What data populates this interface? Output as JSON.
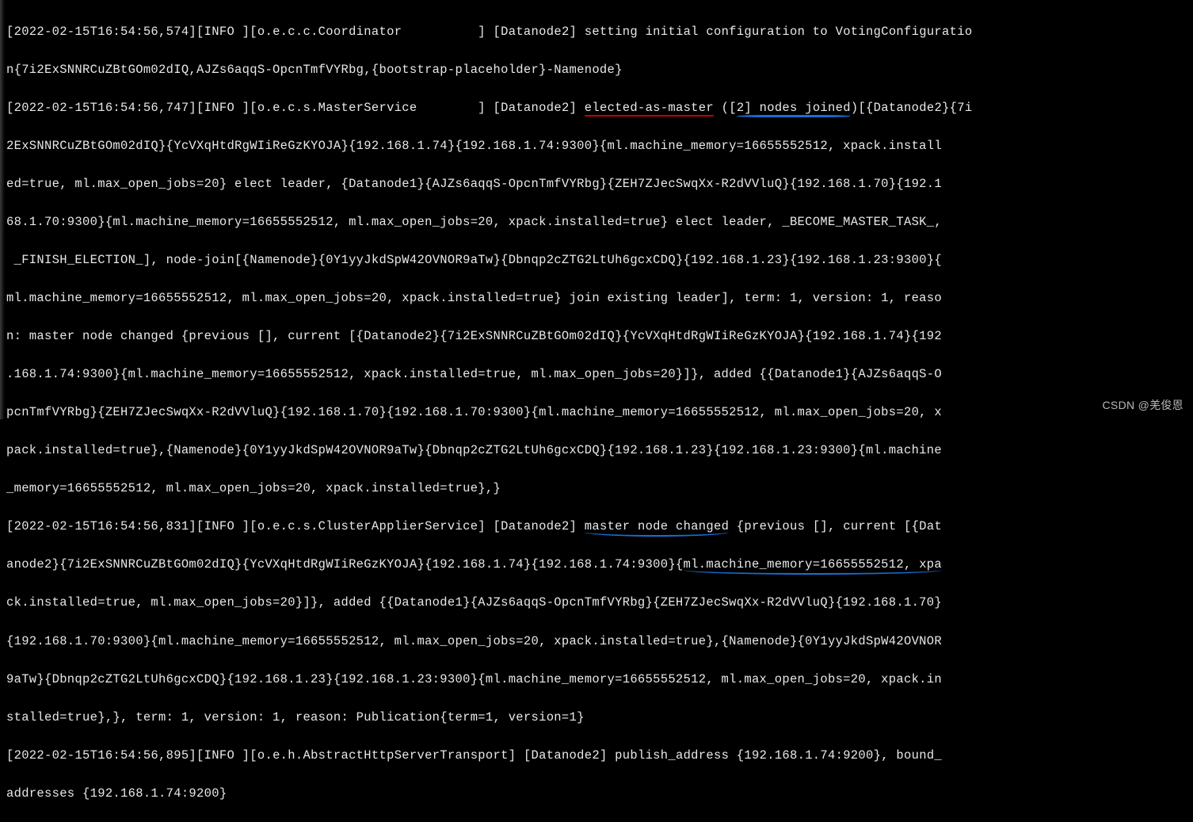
{
  "log_entries": {
    "entry1": {
      "timestamp": "[2022-02-15T16:54:56,574]",
      "level": "[INFO ]",
      "logger": "[o.e.c.c.Coordinator          ]",
      "node": "[Datanode2]",
      "msg_a": " setting initial configuration to VotingConfiguratio",
      "msg_b": "n{7i2ExSNNRCuZBtGOm02dIQ,AJZs6aqqS-OpcnTmfVYRbg,{bootstrap-placeholder}-Namenode}"
    },
    "entry2": {
      "timestamp": "[2022-02-15T16:54:56,747]",
      "level": "[INFO ]",
      "logger": "[o.e.c.s.MasterService        ]",
      "node": "[Datanode2]",
      "elected": "elected-as-master",
      "nodes_joined_prefix": " ([",
      "nodes_joined": "2] nodes joined",
      "nodes_joined_suffix": ")[{Datanode2}{7i",
      "line2": "2ExSNNRCuZBtGOm02dIQ}{YcVXqHtdRgWIiReGzKYOJA}{192.168.1.74}{192.168.1.74:9300}{ml.machine_memory=16655552512, xpack.install",
      "line3": "ed=true, ml.max_open_jobs=20} elect leader, {Datanode1}{AJZs6aqqS-OpcnTmfVYRbg}{ZEH7ZJecSwqXx-R2dVVluQ}{192.168.1.70}{192.1",
      "line4": "68.1.70:9300}{ml.machine_memory=16655552512, ml.max_open_jobs=20, xpack.installed=true} elect leader, _BECOME_MASTER_TASK_,",
      "line5": " _FINISH_ELECTION_], node-join[{Namenode}{0Y1yyJkdSpW42OVNOR9aTw}{Dbnqp2cZTG2LtUh6gcxCDQ}{192.168.1.23}{192.168.1.23:9300}{",
      "line6": "ml.machine_memory=16655552512, ml.max_open_jobs=20, xpack.installed=true} join existing leader], term: 1, version: 1, reaso",
      "line7": "n: master node changed {previous [], current [{Datanode2}{7i2ExSNNRCuZBtGOm02dIQ}{YcVXqHtdRgWIiReGzKYOJA}{192.168.1.74}{192",
      "line8": ".168.1.74:9300}{ml.machine_memory=16655552512, xpack.installed=true, ml.max_open_jobs=20}]}, added {{Datanode1}{AJZs6aqqS-O",
      "line9": "pcnTmfVYRbg}{ZEH7ZJecSwqXx-R2dVVluQ}{192.168.1.70}{192.168.1.70:9300}{ml.machine_memory=16655552512, ml.max_open_jobs=20, x",
      "line10": "pack.installed=true},{Namenode}{0Y1yyJkdSpW42OVNOR9aTw}{Dbnqp2cZTG2LtUh6gcxCDQ}{192.168.1.23}{192.168.1.23:9300}{ml.machine",
      "line11": "_memory=16655552512, ml.max_open_jobs=20, xpack.installed=true},}"
    },
    "entry3": {
      "timestamp": "[2022-02-15T16:54:56,831]",
      "level": "[INFO ]",
      "logger": "[o.e.c.s.ClusterApplierService]",
      "node": "[Datanode2]",
      "master_changed": "master node changed",
      "suffix1": " {previous [], current [{Dat",
      "line2a": "anode2}{7i2ExSNNRCuZBtGOm02dIQ}{YcVXqHtdRgWIiReGzKYOJA}{192.168.1.74}{192.168.1.74:9300}{",
      "line2b": "ml.machine_memory=16655552512, xpa",
      "line3": "ck.installed=true, ml.max_open_jobs=20}]}, added {{Datanode1}{AJZs6aqqS-OpcnTmfVYRbg}{ZEH7ZJecSwqXx-R2dVVluQ}{192.168.1.70}",
      "line4": "{192.168.1.70:9300}{ml.machine_memory=16655552512, ml.max_open_jobs=20, xpack.installed=true},{Namenode}{0Y1yyJkdSpW42OVNOR",
      "line5": "9aTw}{Dbnqp2cZTG2LtUh6gcxCDQ}{192.168.1.23}{192.168.1.23:9300}{ml.machine_memory=16655552512, ml.max_open_jobs=20, xpack.in",
      "line6": "stalled=true},}, term: 1, version: 1, reason: Publication{term=1, version=1}"
    },
    "entry4": {
      "timestamp": "[2022-02-15T16:54:56,895]",
      "level": "[INFO ]",
      "logger": "[o.e.h.AbstractHttpServerTransport]",
      "node": "[Datanode2]",
      "msg_a": " publish_address {192.168.1.74:9200}, bound_",
      "msg_b": "addresses {192.168.1.74:9200}"
    }
  },
  "watermark": "CSDN @羌俊恩"
}
